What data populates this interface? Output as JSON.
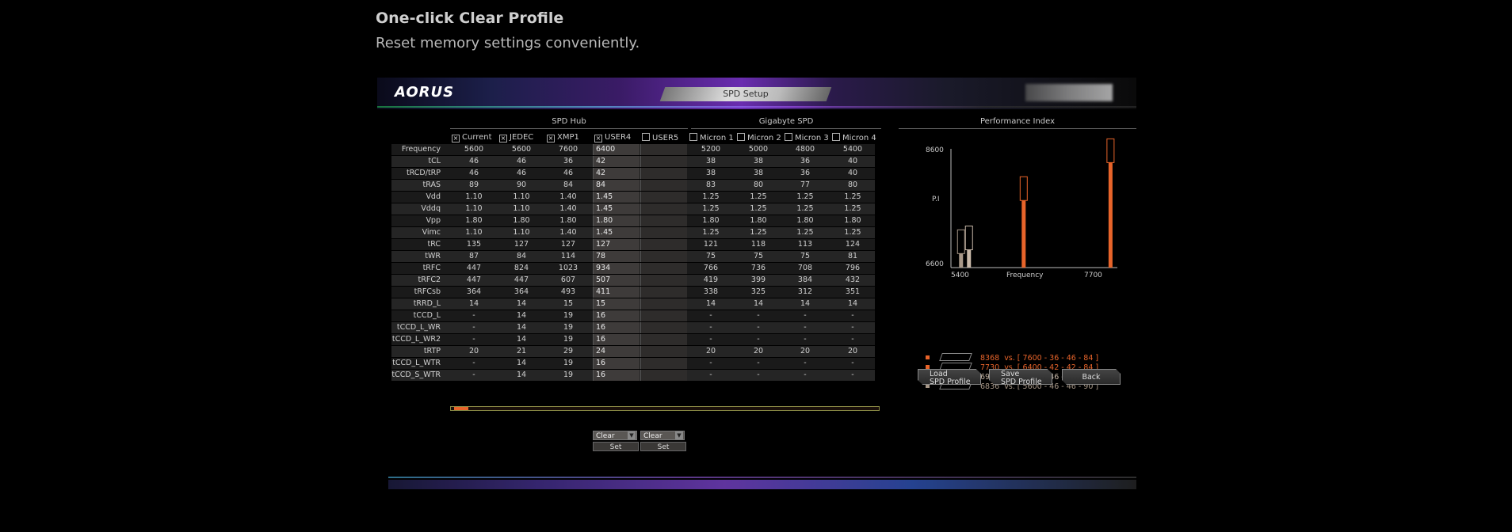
{
  "header": {
    "title": "One-click Clear Profile",
    "subtitle": "Reset memory settings conveniently."
  },
  "bios": {
    "logo": "AORUS",
    "tab_title": "SPD Setup",
    "spd_hub_label": "SPD Hub",
    "gigabyte_spd_label": "Gigabyte SPD",
    "performance_label": "Performance Index",
    "columns": [
      {
        "label": "Current",
        "checked": true
      },
      {
        "label": "JEDEC",
        "checked": true
      },
      {
        "label": "XMP1",
        "checked": true
      },
      {
        "label": "USER4",
        "checked": true
      },
      {
        "label": "USER5",
        "checked": false
      },
      {
        "label": "Micron 1",
        "checked": false
      },
      {
        "label": "Micron 2",
        "checked": false
      },
      {
        "label": "Micron 3",
        "checked": false
      },
      {
        "label": "Micron 4",
        "checked": false
      }
    ],
    "rows": [
      {
        "label": "Frequency",
        "values": [
          "5600",
          "5600",
          "7600",
          "6400",
          "",
          "5200",
          "5000",
          "4800",
          "5400"
        ]
      },
      {
        "label": "tCL",
        "values": [
          "46",
          "46",
          "36",
          "42",
          "",
          "38",
          "38",
          "36",
          "40"
        ]
      },
      {
        "label": "tRCD/tRP",
        "values": [
          "46",
          "46",
          "46",
          "42",
          "",
          "38",
          "38",
          "36",
          "40"
        ]
      },
      {
        "label": "tRAS",
        "values": [
          "89",
          "90",
          "84",
          "84",
          "",
          "83",
          "80",
          "77",
          "80"
        ]
      },
      {
        "label": "Vdd",
        "values": [
          "1.10",
          "1.10",
          "1.40",
          "1.45",
          "",
          "1.25",
          "1.25",
          "1.25",
          "1.25"
        ]
      },
      {
        "label": "Vddq",
        "values": [
          "1.10",
          "1.10",
          "1.40",
          "1.45",
          "",
          "1.25",
          "1.25",
          "1.25",
          "1.25"
        ]
      },
      {
        "label": "Vpp",
        "values": [
          "1.80",
          "1.80",
          "1.80",
          "1.80",
          "",
          "1.80",
          "1.80",
          "1.80",
          "1.80"
        ]
      },
      {
        "label": "Vimc",
        "values": [
          "1.10",
          "1.10",
          "1.40",
          "1.45",
          "",
          "1.25",
          "1.25",
          "1.25",
          "1.25"
        ]
      },
      {
        "label": "tRC",
        "values": [
          "135",
          "127",
          "127",
          "127",
          "",
          "121",
          "118",
          "113",
          "124"
        ]
      },
      {
        "label": "tWR",
        "values": [
          "87",
          "84",
          "114",
          "78",
          "",
          "75",
          "75",
          "75",
          "81"
        ]
      },
      {
        "label": "tRFC",
        "values": [
          "447",
          "824",
          "1023",
          "934",
          "",
          "766",
          "736",
          "708",
          "796"
        ]
      },
      {
        "label": "tRFC2",
        "values": [
          "447",
          "447",
          "607",
          "507",
          "",
          "419",
          "399",
          "384",
          "432"
        ]
      },
      {
        "label": "tRFCsb",
        "values": [
          "364",
          "364",
          "493",
          "411",
          "",
          "338",
          "325",
          "312",
          "351"
        ]
      },
      {
        "label": "tRRD_L",
        "values": [
          "14",
          "14",
          "15",
          "15",
          "",
          "14",
          "14",
          "14",
          "14"
        ]
      },
      {
        "label": "tCCD_L",
        "values": [
          "-",
          "14",
          "19",
          "16",
          "",
          "-",
          "-",
          "-",
          "-"
        ]
      },
      {
        "label": "tCCD_L_WR",
        "values": [
          "-",
          "14",
          "19",
          "16",
          "",
          "-",
          "-",
          "-",
          "-"
        ]
      },
      {
        "label": "tCCD_L_WR2",
        "values": [
          "-",
          "14",
          "19",
          "16",
          "",
          "-",
          "-",
          "-",
          "-"
        ]
      },
      {
        "label": "tRTP",
        "values": [
          "20",
          "21",
          "29",
          "24",
          "",
          "20",
          "20",
          "20",
          "20"
        ]
      },
      {
        "label": "tCCD_L_WTR",
        "values": [
          "-",
          "14",
          "19",
          "16",
          "",
          "-",
          "-",
          "-",
          "-"
        ]
      },
      {
        "label": "tCCD_S_WTR",
        "values": [
          "-",
          "14",
          "19",
          "16",
          "",
          "-",
          "-",
          "-",
          "-"
        ]
      }
    ],
    "dropdown_user4": "Clear",
    "dropdown_user5": "Clear",
    "set_label": "Set",
    "buttons": {
      "load_line1": "Load",
      "load_line2": "SPD Profile",
      "save_line1": "Save",
      "save_line2": "SPD Profile",
      "back": "Back"
    }
  },
  "chart_data": {
    "type": "bar",
    "title": "Performance Index",
    "xlabel": "Frequency",
    "ylabel": "P.I",
    "x_ticks": [
      "5400",
      "7700"
    ],
    "y_ticks": [
      "6600",
      "8600"
    ],
    "xlim": [
      5400,
      7700
    ],
    "ylim": [
      6600,
      8600
    ],
    "series": [
      {
        "name": "XMP1",
        "frequency": 7600,
        "value": 8368,
        "color": "#e8642a"
      },
      {
        "name": "USER4",
        "frequency": 6400,
        "value": 7730,
        "color": "#e8642a"
      },
      {
        "name": "Current",
        "frequency": 5600,
        "value": 6900,
        "color": "#c8b8a8"
      },
      {
        "name": "JEDEC",
        "frequency": 5600,
        "value": 6836,
        "color": "#a89888"
      }
    ],
    "legend": [
      {
        "score": "8368",
        "text": "vs. [ 7600 - 36 - 46 - 84 ]",
        "color": "#e8642a"
      },
      {
        "score": "7730",
        "text": "vs. [ 6400 - 42 - 42 - 84 ]",
        "color": "#e8642a"
      },
      {
        "score": "6900",
        "text": "vs. [ 5600 - 46 - 46 - 89 ]",
        "color": "#c8b8a8"
      },
      {
        "score": "6836",
        "text": "vs. [ 5600 - 46 - 46 - 90 ]",
        "color": "#a89888"
      }
    ]
  }
}
